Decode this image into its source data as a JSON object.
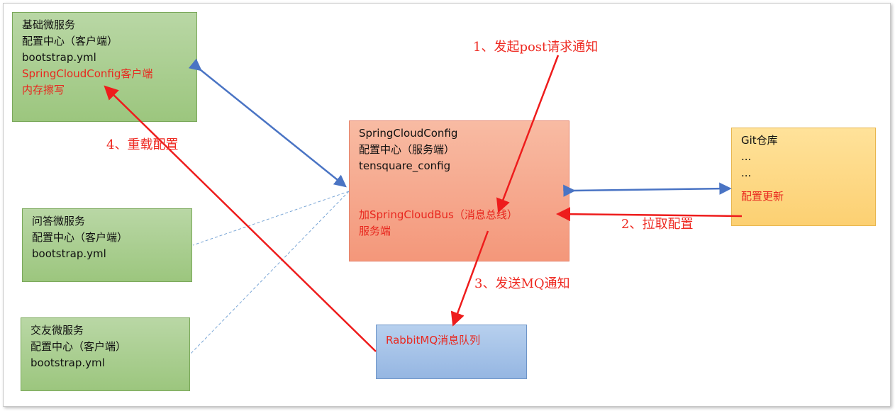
{
  "boxes": {
    "jichu": {
      "lines": [
        "基础微服务",
        "配置中心（客户端）",
        "bootstrap.yml"
      ],
      "red_lines": [
        "SpringCloudConfig客户端",
        "内存擦写"
      ]
    },
    "config_server": {
      "lines": [
        "SpringCloudConfig",
        "配置中心（服务端）",
        "tensquare_config"
      ],
      "red_lines": [
        "加SpringCloudBus（消息总线）",
        "服务端"
      ]
    },
    "git": {
      "lines": [
        "Git仓库",
        "...",
        "..."
      ],
      "red_lines": [
        "配置更新"
      ]
    },
    "wenda": {
      "lines": [
        "问答微服务",
        "配置中心（客户端）",
        "bootstrap.yml"
      ]
    },
    "jiaoyou": {
      "lines": [
        "交友微服务",
        "配置中心（客户端）",
        "bootstrap.yml"
      ]
    },
    "rabbitmq": {
      "red_lines": [
        "RabbitMQ消息队列"
      ]
    }
  },
  "labels": {
    "step1": "1、发起post请求通知",
    "step2": "2、拉取配置",
    "step3": "3、发送MQ通知",
    "step4": "4、重载配置"
  },
  "colors": {
    "red_arrow": "#ee1c1c",
    "blue_arrow": "#4a74c4",
    "dashed": "#7aa6d6"
  }
}
